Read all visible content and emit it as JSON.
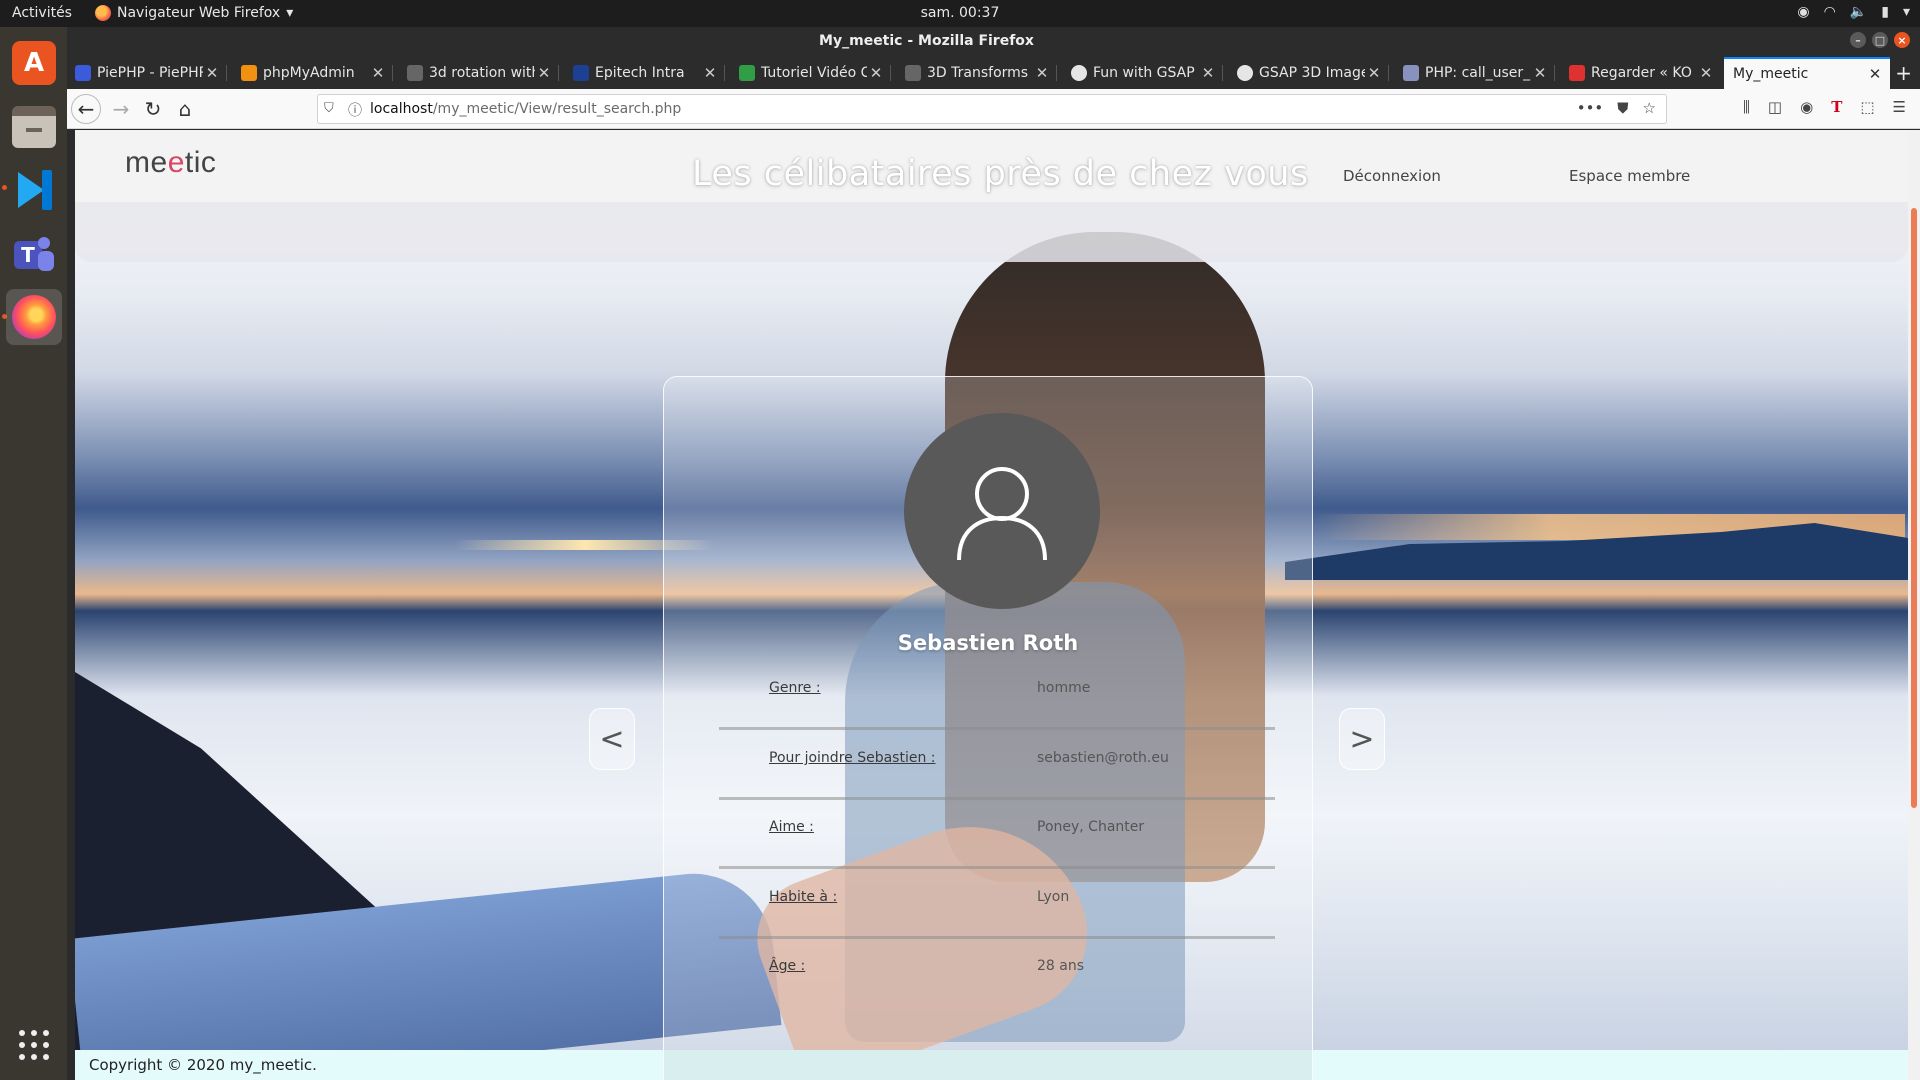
{
  "system": {
    "activities": "Activités",
    "app_menu": "Navigateur Web Firefox",
    "clock": "sam. 00:37"
  },
  "window": {
    "title": "My_meetic - Mozilla Firefox"
  },
  "tabs": [
    {
      "label": "PiePHP - PiePHP",
      "color": "#3b5bdb"
    },
    {
      "label": "phpMyAdmin",
      "color": "#f29111"
    },
    {
      "label": "3d rotation with",
      "color": "#444444"
    },
    {
      "label": "Epitech Intra",
      "color": "#1d3f94"
    },
    {
      "label": "Tutoriel Vidéo C",
      "color": "#2f9e44"
    },
    {
      "label": "3D Transforms",
      "color": "#444444"
    },
    {
      "label": "Fun with GSAP",
      "color": "#e6e6e6"
    },
    {
      "label": "GSAP 3D Image",
      "color": "#e6e6e6"
    },
    {
      "label": "PHP: call_user_",
      "color": "#8892bf"
    },
    {
      "label": "Regarder « KO",
      "color": "#e03131"
    },
    {
      "label": "My_meetic",
      "color": "#d94667"
    }
  ],
  "navbar": {
    "url_host": "localhost",
    "url_path": "/my_meetic/View/result_search.php"
  },
  "site": {
    "logo_prefix": "me",
    "logo_heart": "e",
    "logo_suffix": "tic",
    "headline": "Les célibataires près de chez vous",
    "nav_logout": "Déconnexion",
    "nav_member": "Espace membre",
    "footer": "Copyright © 2020 my_meetic."
  },
  "profile": {
    "name": "Sebastien Roth",
    "fields": [
      {
        "label": "Genre :",
        "value": "homme"
      },
      {
        "label": "Pour joindre Sebastien :",
        "value": "sebastien@roth.eu"
      },
      {
        "label": "Aime :",
        "value": "Poney, Chanter"
      },
      {
        "label": "Habite à :",
        "value": "Lyon"
      },
      {
        "label": "Âge :",
        "value": "28 ans"
      }
    ],
    "prev_label": "<",
    "next_label": ">"
  }
}
